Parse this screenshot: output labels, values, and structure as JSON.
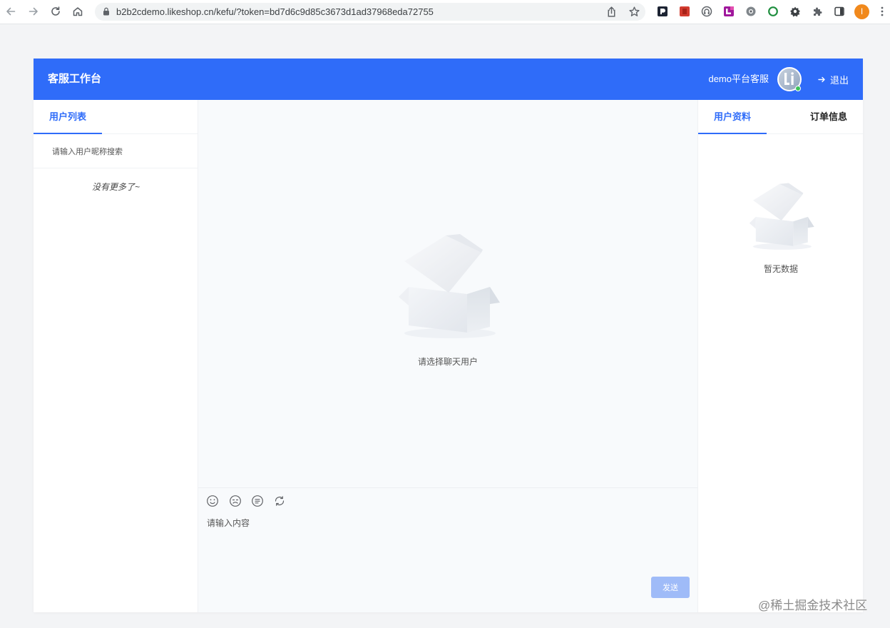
{
  "browser": {
    "url": "b2b2cdemo.likeshop.cn/kefu/?token=bd7d6c9d85c3673d1ad37968eda72755",
    "profile_initial": "I",
    "nav_icons": [
      "back-arrow-icon",
      "forward-arrow-icon",
      "reload-icon",
      "home-icon"
    ],
    "omnibox_icons": [
      "site-info-lock-icon",
      "share-icon",
      "bookmark-star-icon"
    ],
    "extension_icons": [
      "dark-square-extension-icon",
      "red-square-extension-icon",
      "headset-extension-icon",
      "purple-extension-icon",
      "gray-circle-extension-icon",
      "green-ring-extension-icon",
      "gear-extension-icon",
      "puzzle-extensions-icon",
      "side-panel-icon"
    ]
  },
  "header": {
    "title": "客服工作台",
    "agent_name": "demo平台客服",
    "logout_label": "退出",
    "logout_icon": "logout-arrow-icon"
  },
  "user_list": {
    "tabs": [
      {
        "label": "用户列表",
        "active": true
      }
    ],
    "search_placeholder": "请输入用户昵称搜索",
    "empty_text": "没有更多了~"
  },
  "chat": {
    "empty_text": "请选择聊天用户",
    "toolbar_icons": [
      "smile-icon",
      "sticker-face-icon",
      "list-circle-icon",
      "refresh-icon"
    ],
    "input_placeholder": "请输入内容",
    "send_label": "发送"
  },
  "user_info": {
    "tabs": [
      {
        "label": "用户资料",
        "active": true
      },
      {
        "label": "订单信息",
        "active": false
      }
    ],
    "empty_text": "暂无数据"
  },
  "watermark": "@稀土掘金技术社区",
  "colors": {
    "accent": "#2f6cf9",
    "send_button": "#9fbbf8",
    "online_dot": "#3cc35a",
    "profile_avatar": "#f1891c"
  }
}
